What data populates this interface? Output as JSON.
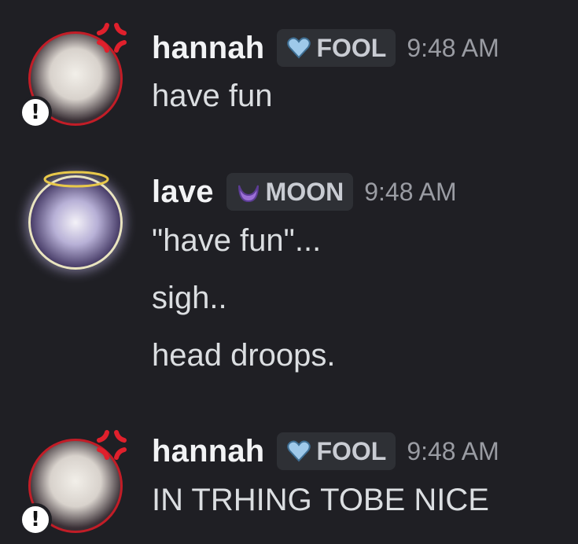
{
  "messages": [
    {
      "author": "hannah",
      "role": "FOOL",
      "role_icon": "heart-icon",
      "time": "9:48 AM",
      "lines": [
        "have fun"
      ]
    },
    {
      "author": "lave",
      "role": "MOON",
      "role_icon": "crescent-moon-icon",
      "time": "9:48 AM",
      "lines": [
        "\"have fun\"...",
        "sigh..",
        "head droops."
      ]
    },
    {
      "author": "hannah",
      "role": "FOOL",
      "role_icon": "heart-icon",
      "time": "9:48 AM",
      "lines": [
        "IN TRHING TOBE NICE"
      ]
    }
  ],
  "colors": {
    "background": "#1f1f24",
    "username": "#f2f3f5",
    "message_text": "#dbdee1",
    "timestamp": "#9a9ca3",
    "role_tag_bg": "#2e3035",
    "heart": "#9ec9ea",
    "moon": "#9b6fd6",
    "anger": "#e0202c"
  }
}
